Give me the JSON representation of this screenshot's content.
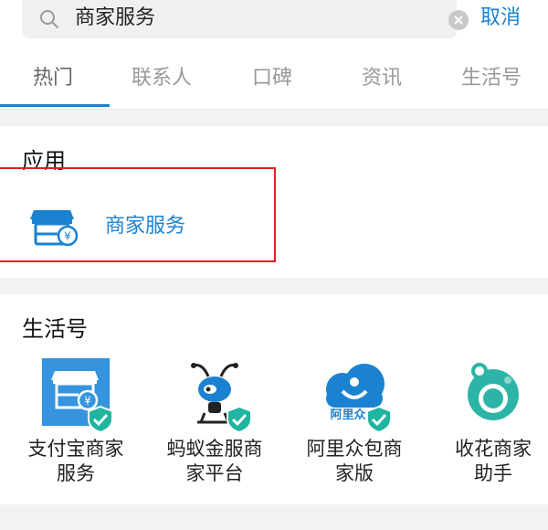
{
  "search": {
    "query": "商家服务",
    "cancel_label": "取消"
  },
  "tabs": [
    "热门",
    "联系人",
    "口碑",
    "资讯",
    "生活号"
  ],
  "apps": {
    "title": "应用",
    "items": [
      {
        "label": "商家服务",
        "icon": "merchant-store-icon"
      }
    ]
  },
  "life_accounts": {
    "title": "生活号",
    "items": [
      {
        "name_line1": "支付宝商家",
        "name_line2": "服务",
        "icon": "alipay-merchant-icon"
      },
      {
        "name_line1": "蚂蚁金服商",
        "name_line2": "家平台",
        "icon": "ant-financial-icon"
      },
      {
        "name_line1": "阿里众包商",
        "name_line2": "家版",
        "icon": "ali-crowdsource-icon",
        "logo_text": "阿里众"
      },
      {
        "name_line1": "收花商家",
        "name_line2": "助手",
        "icon": "flower-merchant-icon"
      }
    ]
  },
  "colors": {
    "accent": "#1b82d2",
    "highlight": "#e02020",
    "verified": "#1fb5a0"
  }
}
